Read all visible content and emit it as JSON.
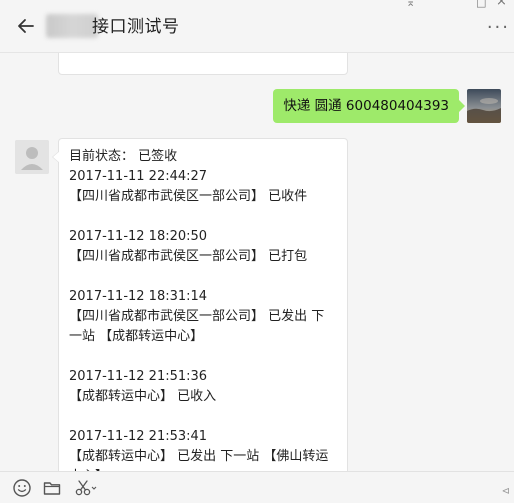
{
  "header": {
    "title": "接口测试号",
    "more_label": "···"
  },
  "window_controls": {
    "pin": "⌅",
    "maximize": "□",
    "close": "×"
  },
  "messages": {
    "sent": {
      "text": "快递 圆通 600480404393"
    },
    "received": {
      "status_line": "目前状态： 已签收",
      "events": [
        {
          "time": "2017-11-11 22:44:27",
          "desc": "【四川省成都市武侯区一部公司】 已收件"
        },
        {
          "time": "2017-11-12 18:20:50",
          "desc": "【四川省成都市武侯区一部公司】 已打包"
        },
        {
          "time": "2017-11-12 18:31:14",
          "desc": "【四川省成都市武侯区一部公司】 已发出 下一站 【成都转运中心】"
        },
        {
          "time": "2017-11-12 21:51:36",
          "desc": "【成都转运中心】 已收入"
        },
        {
          "time": "2017-11-12 21:53:41",
          "desc": "【成都转运中心】 已发出 下一站 【佛山转运中心】"
        }
      ]
    }
  },
  "toolbar": {
    "icons": [
      "emoji-icon",
      "folder-icon",
      "scissors-icon"
    ]
  },
  "colors": {
    "sent_bubble": "#9eea6a",
    "background": "#f5f5f5"
  }
}
